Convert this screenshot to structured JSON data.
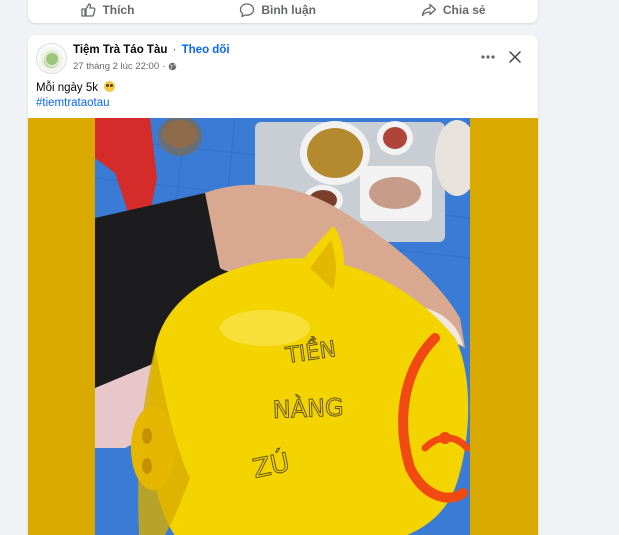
{
  "prev_post": {
    "actions": [
      {
        "label": "Thích",
        "icon": "thumbs-up-icon"
      },
      {
        "label": "Bình luận",
        "icon": "comment-icon"
      },
      {
        "label": "Chia sẻ",
        "icon": "share-icon"
      }
    ]
  },
  "post": {
    "page_name": "Tiệm Trà Táo Tàu",
    "separator": "·",
    "follow_label": "Theo dõi",
    "timestamp": "27 tháng 2 lúc 22:00",
    "meta_separator": "·",
    "privacy_icon": "globe-icon",
    "caption": "Mỗi ngày 5k",
    "caption_emoji": "drooling-face-emoji",
    "hashtag": "#tiemtrataotau",
    "photo_text": [
      "TIỀN",
      "NÀNG",
      "ZÚ"
    ],
    "colors": {
      "accent": "#0866ff",
      "photo_background": "#d9a900",
      "piggy_yellow": "#f4d400",
      "mat_blue": "#3a7bd5"
    }
  }
}
